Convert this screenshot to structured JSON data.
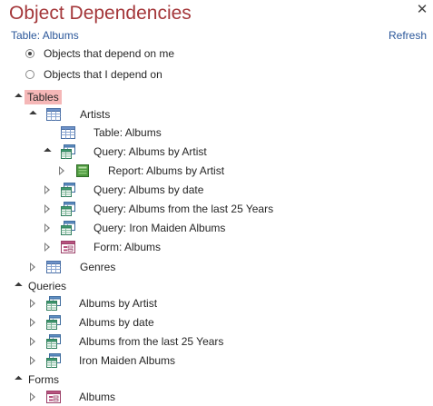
{
  "pane": {
    "title": "Object Dependencies",
    "close_symbol": "✕",
    "subject": "Table: Albums",
    "refresh_label": "Refresh"
  },
  "options": {
    "depend_on_me": {
      "label": "Objects that depend on me",
      "selected": true
    },
    "i_depend_on": {
      "label": "Objects that I depend on",
      "selected": false
    }
  },
  "tree": {
    "tables_label": "Tables",
    "artists": "Artists",
    "artists_children": [
      "Table: Albums",
      "Query: Albums by Artist",
      "Report: Albums by Artist",
      "Query: Albums by date",
      "Query: Albums from the last 25 Years",
      "Query: Iron Maiden Albums",
      "Form: Albums"
    ],
    "genres": "Genres",
    "queries_label": "Queries",
    "queries": [
      "Albums by Artist",
      "Albums by date",
      "Albums from the last 25 Years",
      "Iron Maiden Albums"
    ],
    "forms_label": "Forms",
    "forms": [
      "Albums"
    ]
  },
  "colors": {
    "title": "#a4373a",
    "link": "#2b579a",
    "selected_category_bg": "#f5b7b7"
  },
  "icons": {
    "table": "table-icon",
    "query": "query-icon",
    "report": "report-icon",
    "form": "form-icon"
  }
}
